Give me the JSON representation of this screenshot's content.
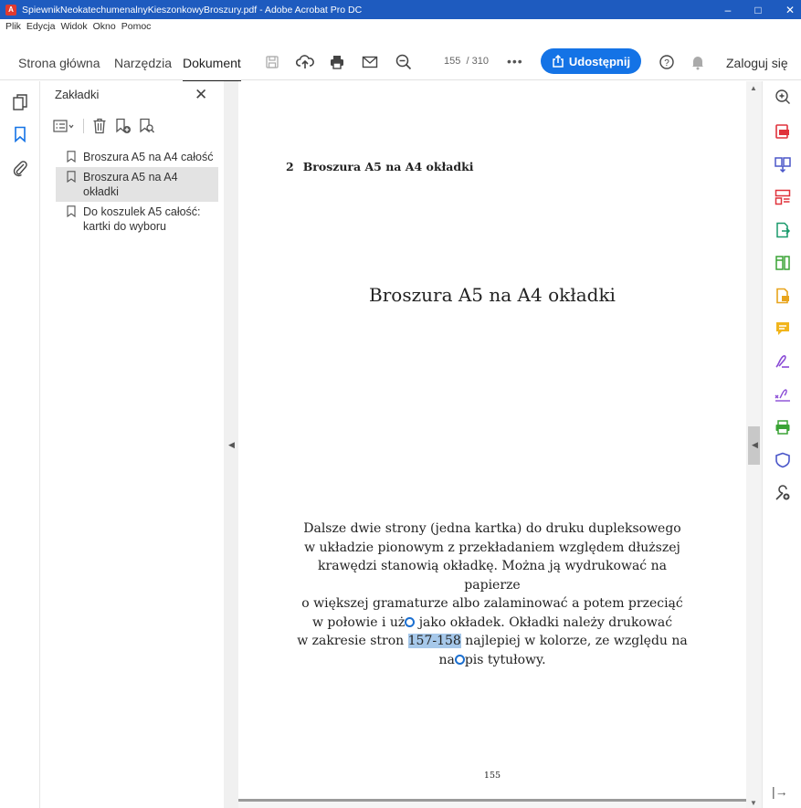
{
  "window": {
    "title": "SpiewnikNeokatechumenalnyKieszonkowyBroszury.pdf - Adobe Acrobat Pro DC",
    "controls": [
      "–",
      "□",
      "✕"
    ]
  },
  "menu": [
    "Plik",
    "Edycja",
    "Widok",
    "Okno",
    "Pomoc"
  ],
  "toolbar": {
    "tabs": [
      "Strona główna",
      "Narzędzia",
      "Dokument"
    ],
    "active_tab": "Dokument",
    "page_current": "155",
    "page_total": "/ 310",
    "more": "•••",
    "share_label": "Udostępnij",
    "login_label": "Zaloguj się",
    "icons": [
      "save-icon",
      "upload-cloud-icon",
      "print-icon",
      "email-icon",
      "zoom-out-icon",
      "help-icon",
      "bell-icon"
    ]
  },
  "bookmarks_panel": {
    "title": "Zakładki",
    "close": "✕",
    "items": [
      {
        "label": "Broszura A5 na A4 całość",
        "selected": false
      },
      {
        "label": "Broszura A5 na A4 okładki",
        "selected": true
      },
      {
        "label": "Do koszulek A5 całość: kartki do wyboru",
        "selected": false
      }
    ]
  },
  "document": {
    "running_head_number": "2",
    "running_head_title": "Broszura A5 na A4 okładki",
    "title": "Broszura A5 na A4 okładki",
    "para_lines": [
      "Dalsze dwie strony (jedna kartka) do druku dupleksowego",
      "w układzie pionowym z przekładaniem względem dłuższej",
      "krawędzi stanowią okładkę. Można ją wydrukować na papierze",
      "o większej gramaturze albo zalaminować a potem przeciąć"
    ],
    "line5_a": "w połowie i uż",
    "line5_b": " jako okładek. Okładki należy drukować",
    "line6_a": "w zakresie stron ",
    "line6_highlight": "157-158",
    "line6_b": " najlepiej w kolorze, ze względu na",
    "line7_a": "na",
    "line7_b": "pis tytułowy.",
    "folio": "155"
  },
  "colors": {
    "titlebar": "#1e5bbf",
    "share_button": "#1473e6",
    "highlight": "#a6c8ea"
  }
}
